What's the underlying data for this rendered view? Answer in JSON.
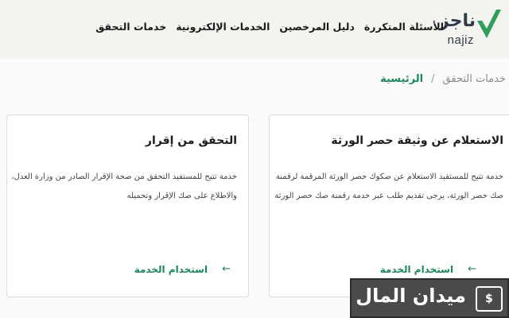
{
  "header": {
    "logo": {
      "arabic": "ناجز",
      "english": "najiz"
    },
    "nav": [
      "خدمات التحقق",
      "الخدمات الإلكترونية",
      "دليل المرخصين",
      "الأسئلة المتكررة"
    ]
  },
  "breadcrumb": {
    "home": "الرئيسية",
    "separator": "/",
    "current": "خدمات التحقق"
  },
  "cards": [
    {
      "title": "الاستعلام عن وثيقة حصر الورثة",
      "description": "خدمة تتيح للمستفيد الاستعلام عن صكوك حصر الورثة المرقمة لرقمنة صك حصر الورثة، يرجى تقديم طلب عبر خدمة رقمنة صك حصر الورثة",
      "link": "استخدام الخدمة"
    },
    {
      "title": "التحقق من إقرار",
      "description": "خدمة تتيح للمستفيد التحقق من صحة الإقرار الصادر من وزارة العدل، والاطلاع على صك الإقرار وتحميله",
      "link": "استخدام الخدمة"
    }
  ],
  "watermark": {
    "text": "ميدان المال",
    "icon": "money-bag-icon"
  },
  "colors": {
    "accent": "#1b8a5a",
    "header_bg": "#f3f3f0",
    "logo_check": "#2e9e5b"
  }
}
